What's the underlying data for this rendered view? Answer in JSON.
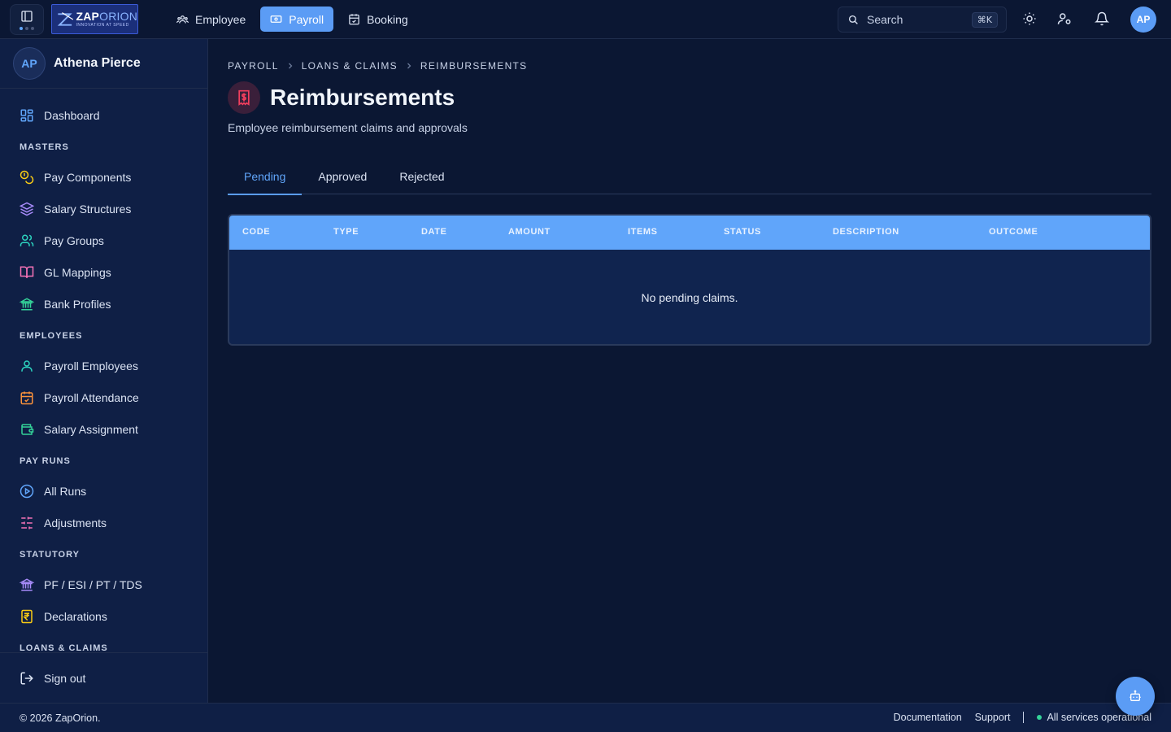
{
  "logo": {
    "name_a": "ZAP",
    "name_b": "ORION",
    "tagline": "INNOVATION AT SPEED"
  },
  "topnav": [
    {
      "label": "Employee",
      "icon": "users-icon",
      "active": false
    },
    {
      "label": "Payroll",
      "icon": "banknote-icon",
      "active": true
    },
    {
      "label": "Booking",
      "icon": "calendar-check-icon",
      "active": false
    }
  ],
  "search": {
    "label": "Search",
    "shortcut": "⌘K"
  },
  "header": {
    "avatar_initials": "AP"
  },
  "user": {
    "initials": "AP",
    "name": "Athena Pierce"
  },
  "sidebar": {
    "dashboard": "Dashboard",
    "sections": {
      "masters": "MASTERS",
      "employees": "EMPLOYEES",
      "pay_runs": "PAY RUNS",
      "statutory": "STATUTORY",
      "loans_claims": "LOANS & CLAIMS"
    },
    "items": {
      "pay_components": "Pay Components",
      "salary_structures": "Salary Structures",
      "pay_groups": "Pay Groups",
      "gl_mappings": "GL Mappings",
      "bank_profiles": "Bank Profiles",
      "payroll_employees": "Payroll Employees",
      "payroll_attendance": "Payroll Attendance",
      "salary_assignment": "Salary Assignment",
      "all_runs": "All Runs",
      "adjustments": "Adjustments",
      "pf_esi": "PF / ESI / PT / TDS",
      "declarations": "Declarations"
    },
    "sign_out": "Sign out"
  },
  "breadcrumb": [
    "PAYROLL",
    "LOANS & CLAIMS",
    "REIMBURSEMENTS"
  ],
  "page": {
    "title": "Reimbursements",
    "subtitle": "Employee reimbursement claims and approvals"
  },
  "tabs": [
    {
      "label": "Pending",
      "active": true
    },
    {
      "label": "Approved",
      "active": false
    },
    {
      "label": "Rejected",
      "active": false
    }
  ],
  "table": {
    "columns": [
      "CODE",
      "TYPE",
      "DATE",
      "AMOUNT",
      "ITEMS",
      "STATUS",
      "DESCRIPTION",
      "OUTCOME"
    ],
    "empty_message": "No pending claims."
  },
  "footer": {
    "copyright": "© 2026 ZapOrion.",
    "documentation": "Documentation",
    "support": "Support",
    "status": "All services operational"
  },
  "colors": {
    "accent": "#5b9cf5",
    "background": "#0b1733",
    "sidebar": "#0f1f45",
    "status_ok": "#34d399"
  }
}
